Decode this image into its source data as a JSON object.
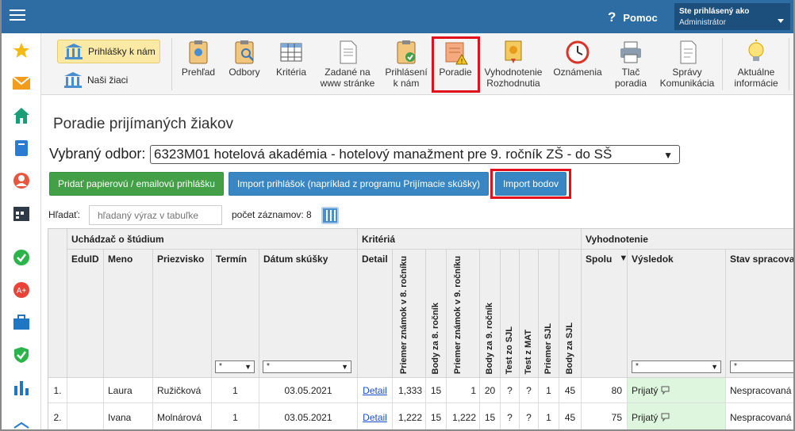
{
  "header": {
    "help_label": "Pomoc",
    "user_title": "Ste prihlásený ako",
    "user_name": "Administrátor"
  },
  "side_tabs": [
    {
      "label": "Prihlášky k nám",
      "active": true
    },
    {
      "label": "Naši žiaci",
      "active": false
    }
  ],
  "toolbar": [
    {
      "label1": "Prehľad",
      "label2": "",
      "icon": "overview-clipboard-icon"
    },
    {
      "label1": "Odbory",
      "label2": "",
      "icon": "search-clipboard-icon"
    },
    {
      "label1": "Kritéria",
      "label2": "",
      "icon": "criteria-grid-icon"
    },
    {
      "label1": "Zadané na",
      "label2": "www stránke",
      "icon": "document-icon"
    },
    {
      "label1": "Prihlásení",
      "label2": "k nám",
      "icon": "check-clipboard-icon"
    },
    {
      "label1": "Poradie",
      "label2": "",
      "icon": "ranking-warning-icon"
    },
    {
      "label1": "Vyhodnotenie",
      "label2": "Rozhodnutia",
      "icon": "certificate-icon"
    },
    {
      "label1": "Oznámenia",
      "label2": "",
      "icon": "clock-icon"
    },
    {
      "label1": "Tlač",
      "label2": "poradia",
      "icon": "printer-icon"
    },
    {
      "label1": "Správy",
      "label2": "Komunikácia",
      "icon": "messages-icon"
    },
    {
      "label1": "Aktuálne",
      "label2": "informácie",
      "icon": "lightbulb-icon"
    }
  ],
  "page": {
    "title": "Poradie prijímaných žiakov",
    "odbor_label": "Vybraný odbor:",
    "odbor_value": "6323M01 hotelová akadémia - hotelový manažment pre 9. ročník ZŠ - do SŠ",
    "btn_add": "Pridať papierovú / emailovú prihlášku",
    "btn_import": "Import prihlášok (napríklad z programu Prijímacie skúšky)",
    "btn_import_points": "Import bodov",
    "search_label": "Hľadať:",
    "search_placeholder": "hľadaný výraz v tabuľke",
    "count_text": "počet záznamov: 8"
  },
  "table": {
    "groups": [
      "Uchádzač o štúdium",
      "Kritériá",
      "Vyhodnotenie"
    ],
    "columns": [
      "EduID",
      "Meno",
      "Priezvisko",
      "Termín",
      "Dátum skúšky",
      "Detail",
      "Priemer známok v 8. ročníku",
      "Body za 8. ročník",
      "Priemer známok v 9. ročníku",
      "Body za 9. ročník",
      "Test zo SJL",
      "Test z MAT",
      "Priemer SJL",
      "Body za SJL",
      "Spolu",
      "Výsledok",
      "Stav spracovania"
    ],
    "sort_indicator": "▼",
    "filter_value": "*",
    "rows": [
      {
        "num": "1.",
        "eduid": "",
        "meno": "Laura",
        "priezvisko": "Ružičková",
        "termin": "1",
        "datum": "03.05.2021",
        "detail": "Detail",
        "p8": "1,333",
        "b8": "15",
        "p9": "1",
        "b9": "20",
        "tsjl": "?",
        "tmat": "?",
        "psjl": "1",
        "bsjl": "45",
        "spolu": "80",
        "vysledok": "Prijatý",
        "stav": "Nespracovaná"
      },
      {
        "num": "2.",
        "eduid": "",
        "meno": "Ivana",
        "priezvisko": "Molnárová",
        "termin": "1",
        "datum": "03.05.2021",
        "detail": "Detail",
        "p8": "1,222",
        "b8": "15",
        "p9": "1,222",
        "b9": "15",
        "tsjl": "?",
        "tmat": "?",
        "psjl": "1",
        "bsjl": "45",
        "spolu": "75",
        "vysledok": "Prijatý",
        "stav": "Nespracovaná"
      }
    ]
  },
  "colors": {
    "topbar": "#2d6da3",
    "highlight": "#e0111b",
    "green_button": "#43a047",
    "blue_button": "#3a86c3",
    "result_bg": "#ddf6dd"
  }
}
